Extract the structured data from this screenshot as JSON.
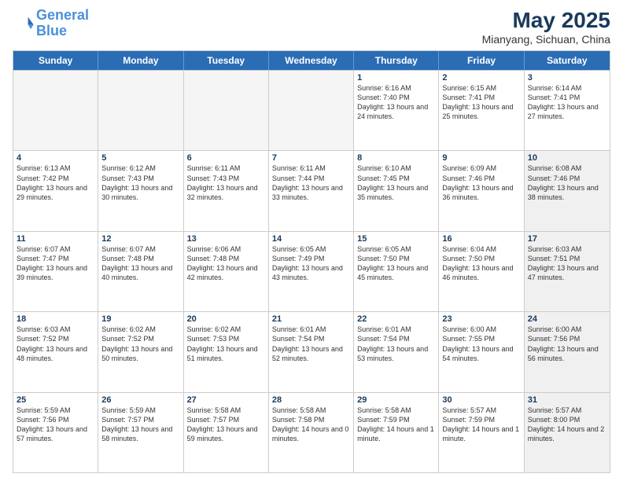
{
  "logo": {
    "line1": "General",
    "line2": "Blue"
  },
  "title": "May 2025",
  "location": "Mianyang, Sichuan, China",
  "days_of_week": [
    "Sunday",
    "Monday",
    "Tuesday",
    "Wednesday",
    "Thursday",
    "Friday",
    "Saturday"
  ],
  "weeks": [
    [
      {
        "day": "",
        "detail": "",
        "empty": true
      },
      {
        "day": "",
        "detail": "",
        "empty": true
      },
      {
        "day": "",
        "detail": "",
        "empty": true
      },
      {
        "day": "",
        "detail": "",
        "empty": true
      },
      {
        "day": "1",
        "detail": "Sunrise: 6:16 AM\nSunset: 7:40 PM\nDaylight: 13 hours\nand 24 minutes."
      },
      {
        "day": "2",
        "detail": "Sunrise: 6:15 AM\nSunset: 7:41 PM\nDaylight: 13 hours\nand 25 minutes."
      },
      {
        "day": "3",
        "detail": "Sunrise: 6:14 AM\nSunset: 7:41 PM\nDaylight: 13 hours\nand 27 minutes."
      }
    ],
    [
      {
        "day": "4",
        "detail": "Sunrise: 6:13 AM\nSunset: 7:42 PM\nDaylight: 13 hours\nand 29 minutes."
      },
      {
        "day": "5",
        "detail": "Sunrise: 6:12 AM\nSunset: 7:43 PM\nDaylight: 13 hours\nand 30 minutes."
      },
      {
        "day": "6",
        "detail": "Sunrise: 6:11 AM\nSunset: 7:43 PM\nDaylight: 13 hours\nand 32 minutes."
      },
      {
        "day": "7",
        "detail": "Sunrise: 6:11 AM\nSunset: 7:44 PM\nDaylight: 13 hours\nand 33 minutes."
      },
      {
        "day": "8",
        "detail": "Sunrise: 6:10 AM\nSunset: 7:45 PM\nDaylight: 13 hours\nand 35 minutes."
      },
      {
        "day": "9",
        "detail": "Sunrise: 6:09 AM\nSunset: 7:46 PM\nDaylight: 13 hours\nand 36 minutes."
      },
      {
        "day": "10",
        "detail": "Sunrise: 6:08 AM\nSunset: 7:46 PM\nDaylight: 13 hours\nand 38 minutes.",
        "shaded": true
      }
    ],
    [
      {
        "day": "11",
        "detail": "Sunrise: 6:07 AM\nSunset: 7:47 PM\nDaylight: 13 hours\nand 39 minutes."
      },
      {
        "day": "12",
        "detail": "Sunrise: 6:07 AM\nSunset: 7:48 PM\nDaylight: 13 hours\nand 40 minutes."
      },
      {
        "day": "13",
        "detail": "Sunrise: 6:06 AM\nSunset: 7:48 PM\nDaylight: 13 hours\nand 42 minutes."
      },
      {
        "day": "14",
        "detail": "Sunrise: 6:05 AM\nSunset: 7:49 PM\nDaylight: 13 hours\nand 43 minutes."
      },
      {
        "day": "15",
        "detail": "Sunrise: 6:05 AM\nSunset: 7:50 PM\nDaylight: 13 hours\nand 45 minutes."
      },
      {
        "day": "16",
        "detail": "Sunrise: 6:04 AM\nSunset: 7:50 PM\nDaylight: 13 hours\nand 46 minutes."
      },
      {
        "day": "17",
        "detail": "Sunrise: 6:03 AM\nSunset: 7:51 PM\nDaylight: 13 hours\nand 47 minutes.",
        "shaded": true
      }
    ],
    [
      {
        "day": "18",
        "detail": "Sunrise: 6:03 AM\nSunset: 7:52 PM\nDaylight: 13 hours\nand 48 minutes."
      },
      {
        "day": "19",
        "detail": "Sunrise: 6:02 AM\nSunset: 7:52 PM\nDaylight: 13 hours\nand 50 minutes."
      },
      {
        "day": "20",
        "detail": "Sunrise: 6:02 AM\nSunset: 7:53 PM\nDaylight: 13 hours\nand 51 minutes."
      },
      {
        "day": "21",
        "detail": "Sunrise: 6:01 AM\nSunset: 7:54 PM\nDaylight: 13 hours\nand 52 minutes."
      },
      {
        "day": "22",
        "detail": "Sunrise: 6:01 AM\nSunset: 7:54 PM\nDaylight: 13 hours\nand 53 minutes."
      },
      {
        "day": "23",
        "detail": "Sunrise: 6:00 AM\nSunset: 7:55 PM\nDaylight: 13 hours\nand 54 minutes."
      },
      {
        "day": "24",
        "detail": "Sunrise: 6:00 AM\nSunset: 7:56 PM\nDaylight: 13 hours\nand 56 minutes.",
        "shaded": true
      }
    ],
    [
      {
        "day": "25",
        "detail": "Sunrise: 5:59 AM\nSunset: 7:56 PM\nDaylight: 13 hours\nand 57 minutes."
      },
      {
        "day": "26",
        "detail": "Sunrise: 5:59 AM\nSunset: 7:57 PM\nDaylight: 13 hours\nand 58 minutes."
      },
      {
        "day": "27",
        "detail": "Sunrise: 5:58 AM\nSunset: 7:57 PM\nDaylight: 13 hours\nand 59 minutes."
      },
      {
        "day": "28",
        "detail": "Sunrise: 5:58 AM\nSunset: 7:58 PM\nDaylight: 14 hours\nand 0 minutes."
      },
      {
        "day": "29",
        "detail": "Sunrise: 5:58 AM\nSunset: 7:59 PM\nDaylight: 14 hours\nand 1 minute."
      },
      {
        "day": "30",
        "detail": "Sunrise: 5:57 AM\nSunset: 7:59 PM\nDaylight: 14 hours\nand 1 minute."
      },
      {
        "day": "31",
        "detail": "Sunrise: 5:57 AM\nSunset: 8:00 PM\nDaylight: 14 hours\nand 2 minutes.",
        "shaded": true
      }
    ]
  ]
}
